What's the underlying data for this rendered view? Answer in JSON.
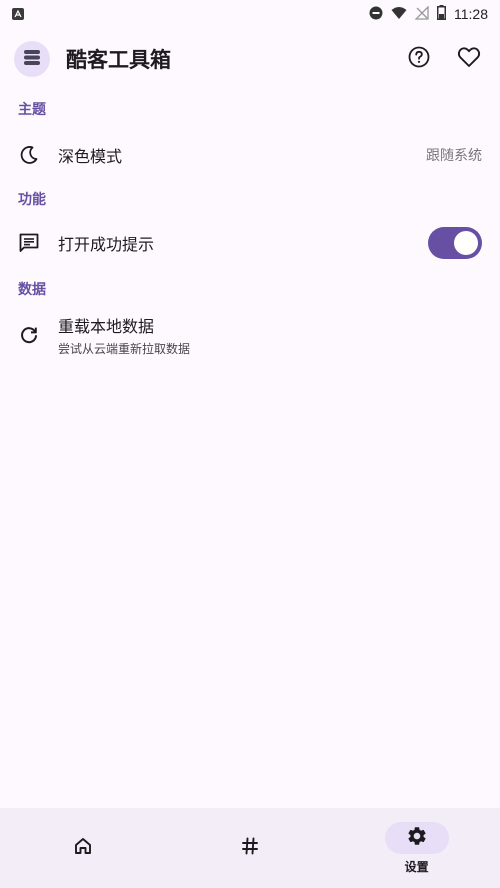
{
  "status_bar": {
    "time": "11:28",
    "icons": [
      "notification-a-icon",
      "dnd-icon",
      "wifi-icon",
      "no-signal-icon",
      "battery-icon"
    ]
  },
  "app_bar": {
    "title": "酷客工具箱",
    "logo_icon": "stack-icon",
    "actions": [
      "help-icon",
      "favorite-icon"
    ]
  },
  "sections": {
    "theme": {
      "header": "主题",
      "dark_mode": {
        "title": "深色模式",
        "value": "跟随系统",
        "icon": "moon-icon"
      }
    },
    "features": {
      "header": "功能",
      "open_tip": {
        "title": "打开成功提示",
        "icon": "message-icon",
        "enabled": true
      }
    },
    "data": {
      "header": "数据",
      "reload": {
        "title": "重载本地数据",
        "subtitle": "尝试从云端重新拉取数据",
        "icon": "refresh-icon"
      }
    }
  },
  "bottom_nav": {
    "items": [
      {
        "icon": "home-icon",
        "label": ""
      },
      {
        "icon": "hash-icon",
        "label": ""
      },
      {
        "icon": "gear-icon",
        "label": "设置",
        "active": true
      }
    ]
  },
  "colors": {
    "accent": "#6750a4",
    "background": "#fdf9fe",
    "nav_background": "#f3edf7",
    "active_pill": "#e8def8"
  }
}
